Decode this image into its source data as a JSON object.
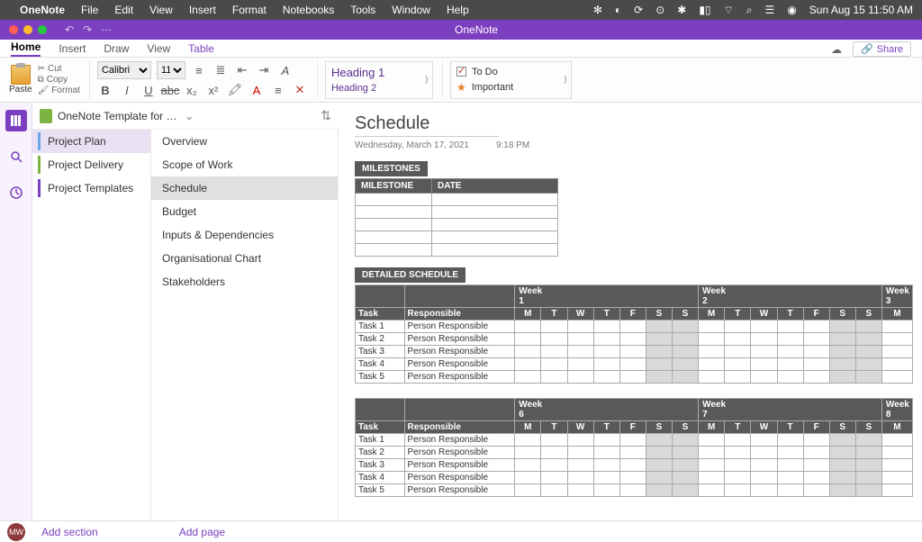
{
  "mac_menu": {
    "app_name": "OneNote",
    "items": [
      "File",
      "Edit",
      "View",
      "Insert",
      "Format",
      "Notebooks",
      "Tools",
      "Window",
      "Help"
    ],
    "clock": "Sun Aug 15  11:50 AM"
  },
  "title_bar": {
    "title": "OneNote"
  },
  "tabs": {
    "items": [
      "Home",
      "Insert",
      "Draw",
      "View",
      "Table"
    ],
    "active": "Home",
    "share": "Share"
  },
  "ribbon": {
    "paste": "Paste",
    "cut": "Cut",
    "copy": "Copy",
    "format": "Format",
    "font_name": "Calibri",
    "font_size": "11",
    "heading1": "Heading 1",
    "heading2": "Heading 2",
    "todo": "To Do",
    "important": "Important"
  },
  "notebook": {
    "title": "OneNote Template for Project Management",
    "sections": [
      {
        "label": "Project Plan",
        "color": "blue",
        "active": true
      },
      {
        "label": "Project Delivery",
        "color": "green",
        "active": false
      },
      {
        "label": "Project Templates",
        "color": "purple",
        "active": false
      }
    ]
  },
  "pages": [
    {
      "label": "Overview",
      "active": false
    },
    {
      "label": "Scope of Work",
      "active": false
    },
    {
      "label": "Schedule",
      "active": true
    },
    {
      "label": "Budget",
      "active": false
    },
    {
      "label": "Inputs & Dependencies",
      "active": false
    },
    {
      "label": "Organisational Chart",
      "active": false
    },
    {
      "label": "Stakeholders",
      "active": false
    }
  ],
  "page": {
    "title": "Schedule",
    "date": "Wednesday, March 17, 2021",
    "time": "9:18 PM"
  },
  "milestones": {
    "header": "MILESTONES",
    "col1": "MILESTONE",
    "col2": "DATE",
    "rows": 5
  },
  "detailed": {
    "header": "DETAILED SCHEDULE",
    "task_hdr": "Task",
    "resp_hdr": "Responsible",
    "weeks_a": [
      "Week 1",
      "Week 2",
      "Week 3"
    ],
    "weeks_b": [
      "Week 6",
      "Week 7",
      "Week 8"
    ],
    "days": [
      "M",
      "T",
      "W",
      "T",
      "F",
      "S",
      "S"
    ],
    "tasks": [
      {
        "name": "Task 1",
        "resp": "Person Responsible"
      },
      {
        "name": "Task 2",
        "resp": "Person Responsible"
      },
      {
        "name": "Task 3",
        "resp": "Person Responsible"
      },
      {
        "name": "Task 4",
        "resp": "Person Responsible"
      },
      {
        "name": "Task 5",
        "resp": "Person Responsible"
      }
    ]
  },
  "footer": {
    "avatar": "MW",
    "add_section": "Add section",
    "add_page": "Add page"
  }
}
